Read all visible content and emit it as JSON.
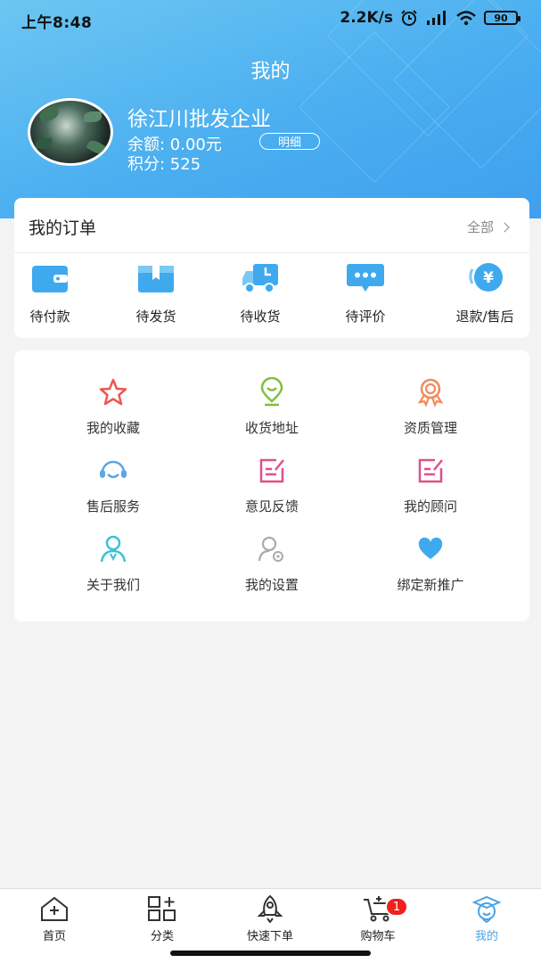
{
  "status_bar": {
    "time": "上午8:48",
    "speed": "2.2K/s",
    "battery": "90"
  },
  "header": {
    "title": "我的",
    "company": "徐江川批发企业",
    "balance_label": "余额: 0.00元",
    "detail_button": "明细",
    "points_label": "积分: 525"
  },
  "orders": {
    "title": "我的订单",
    "all_label": "全部",
    "items": [
      {
        "label": "待付款",
        "icon": "wallet-icon"
      },
      {
        "label": "待发货",
        "icon": "package-icon"
      },
      {
        "label": "待收货",
        "icon": "truck-icon"
      },
      {
        "label": "待评价",
        "icon": "chat-icon"
      },
      {
        "label": "退款/售后",
        "icon": "refund-icon"
      }
    ]
  },
  "services": [
    {
      "label": "我的收藏",
      "icon": "star-icon"
    },
    {
      "label": "收货地址",
      "icon": "location-icon"
    },
    {
      "label": "资质管理",
      "icon": "badge-icon"
    },
    {
      "label": "售后服务",
      "icon": "headset-icon"
    },
    {
      "label": "意见反馈",
      "icon": "edit-icon"
    },
    {
      "label": "我的顾问",
      "icon": "edit-icon"
    },
    {
      "label": "关于我们",
      "icon": "person-icon"
    },
    {
      "label": "我的设置",
      "icon": "user-settings-icon"
    },
    {
      "label": "绑定新推广",
      "icon": "heart-icon"
    }
  ],
  "nav": {
    "items": [
      {
        "label": "首页",
        "icon": "home-icon"
      },
      {
        "label": "分类",
        "icon": "category-icon"
      },
      {
        "label": "快速下单",
        "icon": "rocket-icon"
      },
      {
        "label": "购物车",
        "icon": "cart-icon"
      },
      {
        "label": "我的",
        "icon": "profile-icon"
      }
    ],
    "active_index": 4,
    "cart_badge": "1"
  },
  "colors": {
    "header_gradient_start": "#6cc6f2",
    "header_gradient_end": "#3f9fee",
    "order_icon_blue": "#3fa9ee",
    "nav_active": "#4aa3e6",
    "badge_red": "#f02020"
  }
}
